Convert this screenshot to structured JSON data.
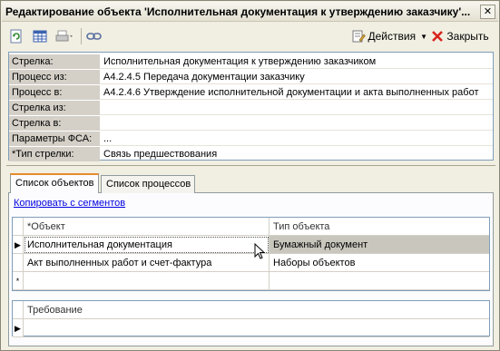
{
  "window": {
    "title": "Редактирование объекта 'Исполнительная документация к утверждению заказчику'...",
    "close_glyph": "✕"
  },
  "toolbar": {
    "actions_label": "Действия",
    "close_label": "Закрыть",
    "icons": [
      "refresh-icon",
      "grid-view-icon",
      "print-icon",
      "link-icon",
      "actions-icon",
      "close-icon"
    ]
  },
  "properties": [
    {
      "label": "Стрелка:",
      "value": "Исполнительная документация к утверждению заказчиком"
    },
    {
      "label": "Процесс из:",
      "value": "А4.2.4.5 Передача документации заказчику"
    },
    {
      "label": "Процесс в:",
      "value": "А4.2.4.6 Утверждение исполнительной документации и акта выполненных работ"
    },
    {
      "label": "Стрелка из:",
      "value": ""
    },
    {
      "label": "Стрелка в:",
      "value": ""
    },
    {
      "label": "Параметры ФСА:",
      "value": "..."
    },
    {
      "label": "*Тип стрелки:",
      "value": "Связь предшествования"
    }
  ],
  "tabs": [
    {
      "label": "Список объектов",
      "active": true
    },
    {
      "label": "Список процессов",
      "active": false
    }
  ],
  "copy_link": "Копировать с сегментов",
  "objects_table": {
    "columns": [
      "*Объект",
      "Тип объекта"
    ],
    "rows": [
      {
        "marker": "▶",
        "object": "Исполнительная документация",
        "type": "Бумажный документ",
        "selected": true
      },
      {
        "marker": "",
        "object": "Акт выполненных работ и счет-фактура",
        "type": "Наборы объектов",
        "selected": false
      },
      {
        "marker": "*",
        "object": "",
        "type": "",
        "selected": false
      }
    ]
  },
  "requirements_table": {
    "columns": [
      "Требование"
    ],
    "rows": [
      {
        "marker": "▶",
        "value": ""
      }
    ]
  },
  "colors": {
    "accent_tab": "#e68b2c",
    "link": "#0000e0",
    "selection": "#c9c7bd"
  }
}
